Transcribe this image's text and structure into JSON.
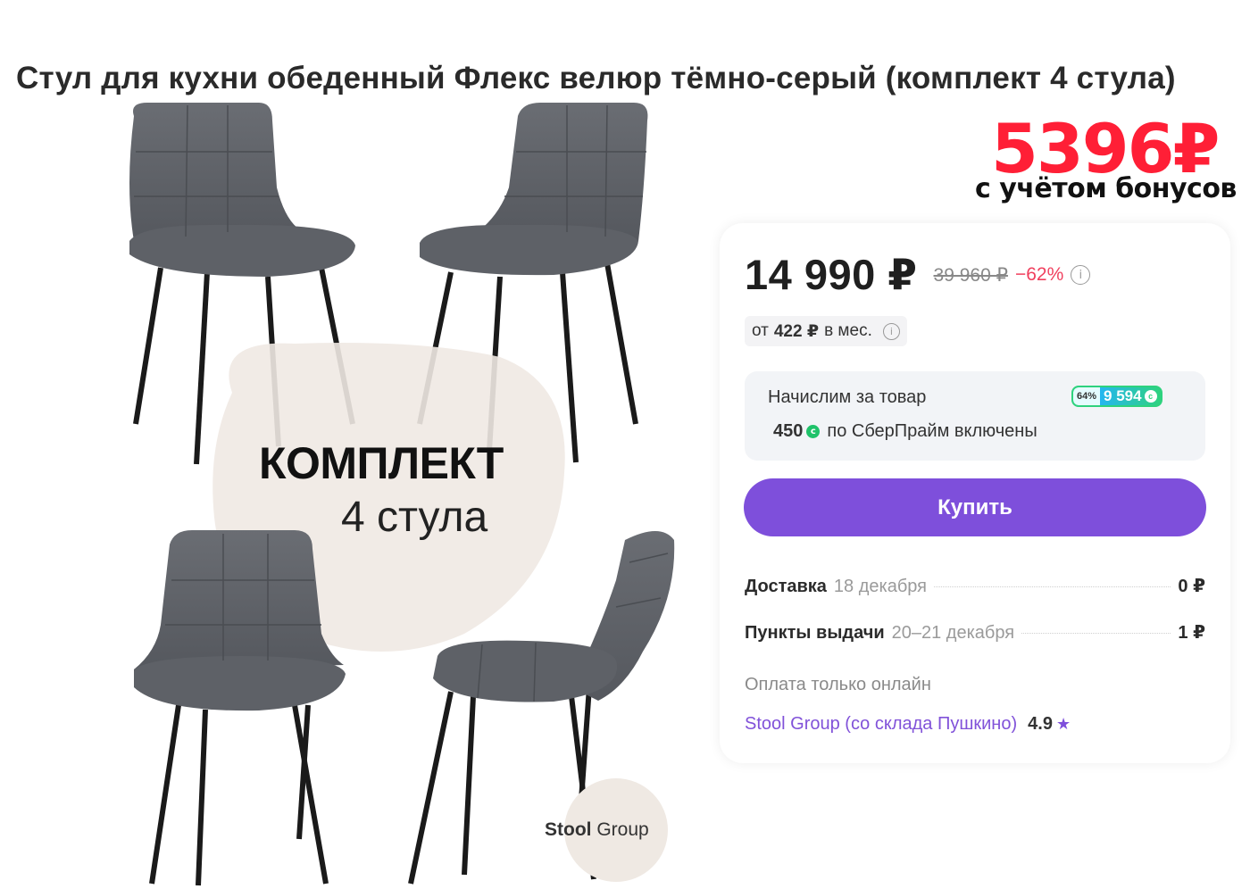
{
  "product": {
    "title": "Стул для кухни обеденный Флекс велюр тёмно-серый (комплект 4 стула)",
    "image": {
      "kit_title": "КОМПЛЕКТ",
      "kit_subtitle": "4 стула",
      "brand_logo_bold": "Stool",
      "brand_logo_light": "Group"
    }
  },
  "promo": {
    "price": "5396₽",
    "caption": "с учётом бонусов",
    "color": "#ff1f36"
  },
  "buy_card": {
    "price": "14 990 ₽",
    "old_price": "39 960 ₽",
    "discount": "−62%",
    "installment": {
      "prefix": "от",
      "amount": "422 ₽",
      "suffix": "в мес."
    },
    "bonus": {
      "title": "Начислим за товар",
      "badge_percent": "64%",
      "badge_value": "9 594",
      "prime_amount": "450",
      "prime_text": "по СберПрайм включены"
    },
    "buy_label": "Купить",
    "accent_color": "#7e4fdb",
    "delivery": [
      {
        "label": "Доставка",
        "date": "18 декабря",
        "cost": "0 ₽"
      },
      {
        "label": "Пункты выдачи",
        "date": "20–21 декабря",
        "cost": "1 ₽"
      }
    ],
    "payment_note": "Оплата только онлайн",
    "seller": {
      "name": "Stool Group (со склада Пушкино)",
      "rating": "4.9"
    }
  },
  "icons": [
    "info-icon",
    "bonus-coin-icon",
    "star-icon"
  ]
}
